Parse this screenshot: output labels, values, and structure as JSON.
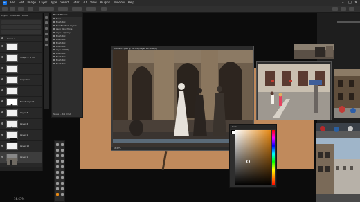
{
  "menubar": {
    "app_icon": "Ps",
    "items": [
      "File",
      "Edit",
      "Image",
      "Layer",
      "Type",
      "Select",
      "Filter",
      "3D",
      "View",
      "Plugins",
      "Window",
      "Help"
    ]
  },
  "layers_panel": {
    "tabs": [
      "Layers",
      "Channels",
      "Paths"
    ],
    "layers": [
      {
        "name": "Group 1"
      },
      {
        "name": ""
      },
      {
        "name": "Shape ... 1 Sh"
      },
      {
        "name": ""
      },
      {
        "name": "Unpacked"
      },
      {
        "name": ""
      },
      {
        "name": "Brush Layer 1"
      },
      {
        "name": "Layer 3"
      },
      {
        "name": "Layer 4"
      },
      {
        "name": "Layer 1"
      },
      {
        "name": "Layer 10"
      },
      {
        "name": "Layer 1"
      }
    ]
  },
  "history_panel": {
    "title": "Brush Presets",
    "items": [
      "Move",
      "Brush Tool",
      "Free Transform Layer 1",
      "Layer Blend Mode",
      "Layer 1 Opacity",
      "Brush Tool",
      "Brush Tool",
      "Brush Tool",
      "Brush Tool",
      "Layer Visibility",
      "Brush Tool",
      "Brush Tool",
      "Brush Tool",
      "Brush Tool"
    ],
    "footer": "Shape ... Tool (Cmd)"
  },
  "painting_window": {
    "title": "untitled-1.psd @ 66.7% (Layer 10, RGB/8)",
    "status": "66.67%"
  },
  "color_picker": {
    "title": "Color",
    "field_hue": "#e88a14"
  },
  "status_left": "16.67%",
  "colors": {
    "canvas_orange": "#c08a5c",
    "ps_blue": "#1473e6",
    "panel_bg": "#282828"
  }
}
